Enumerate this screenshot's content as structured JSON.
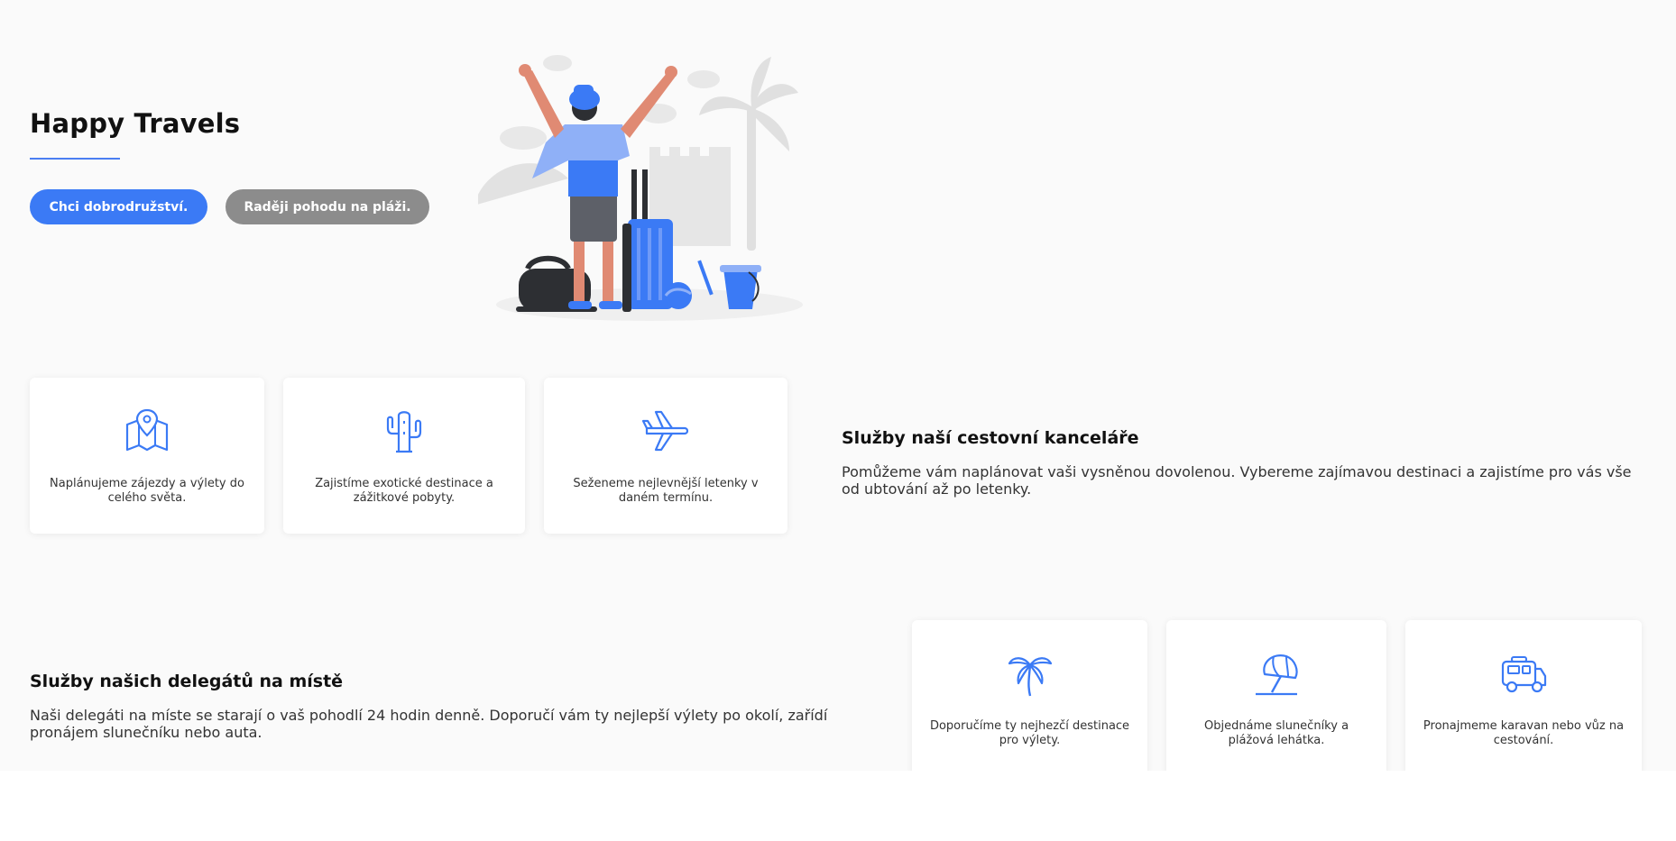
{
  "hero": {
    "title": "Happy Travels",
    "button_adventure": "Chci dobrodružství.",
    "button_beach": "Raději pohodu na pláži."
  },
  "agency": {
    "title": "Služby naší cestovní kanceláře",
    "text": "Pomůžeme vám naplánovat vaši vysněnou dovolenou. Vybereme zajímavou destinaci a zajistíme pro vás vše od ubtování až po letenky.",
    "cards": [
      {
        "icon": "map-pin-icon",
        "text": "Naplánujeme zájezdy a výlety do celého světa."
      },
      {
        "icon": "cactus-icon",
        "text": "Zajistíme exotické destinace a zážitkové pobyty."
      },
      {
        "icon": "airplane-icon",
        "text": "Seženeme nejlevnější letenky v daném termínu."
      }
    ]
  },
  "delegates": {
    "title": "Služby našich delegátů na místě",
    "text": "Naši delegáti na míste se starají o vaš pohodlí 24 hodin denně. Doporučí vám ty nejlepší výlety po okolí, zařídí pronájem slunečníku nebo auta.",
    "cards": [
      {
        "icon": "palm-tree-icon",
        "text": "Doporučíme ty nejhezčí destinace pro výlety."
      },
      {
        "icon": "beach-umbrella-icon",
        "text": "Objednáme slunečníky a plážová lehátka."
      },
      {
        "icon": "camper-van-icon",
        "text": "Pronajmeme karavan nebo vůz na cestování."
      }
    ]
  },
  "colors": {
    "accent": "#3b7af5",
    "secondary_button": "#8c8c8c",
    "background": "#fafafa"
  }
}
